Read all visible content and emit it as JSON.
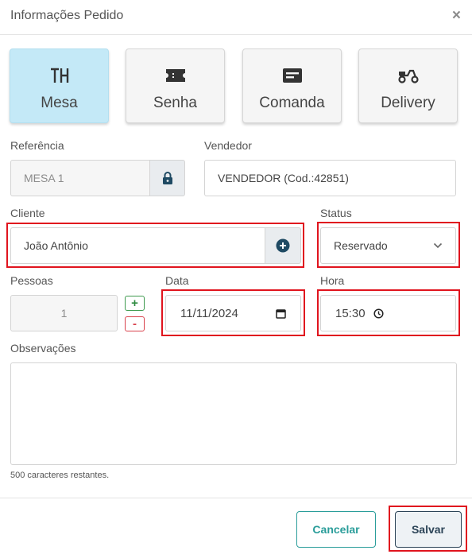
{
  "dialog": {
    "title": "Informações Pedido",
    "close_label": "×"
  },
  "types": [
    {
      "label": "Mesa",
      "icon": "table-icon",
      "active": true
    },
    {
      "label": "Senha",
      "icon": "ticket-icon",
      "active": false
    },
    {
      "label": "Comanda",
      "icon": "card-icon",
      "active": false
    },
    {
      "label": "Delivery",
      "icon": "scooter-icon",
      "active": false
    }
  ],
  "form": {
    "referencia": {
      "label": "Referência",
      "value": "MESA 1"
    },
    "vendedor": {
      "label": "Vendedor",
      "value": "VENDEDOR (Cod.:42851)"
    },
    "cliente": {
      "label": "Cliente",
      "value": "João Antônio"
    },
    "status": {
      "label": "Status",
      "value": "Reservado"
    },
    "pessoas": {
      "label": "Pessoas",
      "value": "1",
      "plus": "+",
      "minus": "-"
    },
    "data": {
      "label": "Data",
      "value": "11/11/2024"
    },
    "hora": {
      "label": "Hora",
      "value": "15:30"
    },
    "observacoes": {
      "label": "Observações",
      "remaining": "500 caracteres restantes."
    }
  },
  "footer": {
    "cancel_label": "Cancelar",
    "save_label": "Salvar"
  },
  "colors": {
    "active_card": "#c4e9f7",
    "highlight": "#e0141e",
    "accent_teal": "#2a9d9a",
    "save_text": "#2c4457"
  }
}
